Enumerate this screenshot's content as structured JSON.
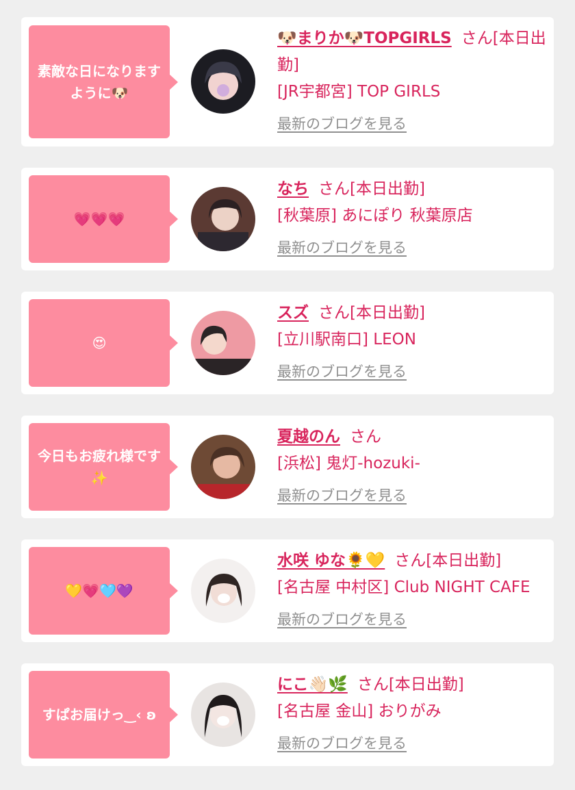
{
  "cards": [
    {
      "message": "素敵な日になりますように🐶",
      "name": "🐶まりか🐶TOPGIRLS",
      "suffix": "さん[本日出勤]",
      "shop": "[JR宇都宮] TOP GIRLS",
      "blog_link": "最新のブログを見る",
      "avatar_colors": [
        "#1c1c22",
        "#f1d3d0",
        "#3a3a48"
      ]
    },
    {
      "message": "💗💗💗",
      "name": "なち",
      "suffix": "さん[本日出勤]",
      "shop": "[秋葉原] あにぽり 秋葉原店",
      "blog_link": "最新のブログを見る",
      "avatar_colors": [
        "#5b3a33",
        "#ecd2c6",
        "#2b2022"
      ]
    },
    {
      "message": "😍",
      "name": "スズ",
      "suffix": "さん[本日出勤]",
      "shop": "[立川駅南口] LEON",
      "blog_link": "最新のブログを見る",
      "avatar_colors": [
        "#ee9aa3",
        "#f4d8cc",
        "#2a2426"
      ]
    },
    {
      "message": "今日もお疲れ様です✨",
      "name": "夏越のん",
      "suffix": "さん",
      "shop": "[浜松] 鬼灯-hozuki-",
      "blog_link": "最新のブログを見る",
      "avatar_colors": [
        "#6e4a35",
        "#e6b9a3",
        "#b7262b"
      ]
    },
    {
      "message": "💛💗🩵💜",
      "name": "水咲 ゆな🌻💛",
      "suffix": "さん[本日出勤]",
      "shop": "[名古屋 中村区] Club NIGHT CAFE",
      "blog_link": "最新のブログを見る",
      "avatar_colors": [
        "#f3f0ef",
        "#f1ddd6",
        "#2f2523"
      ]
    },
    {
      "message": "すぱお届けっ‿‹ ʚ",
      "name": "にこ👋🏻🌿",
      "suffix": "さん[本日出勤]",
      "shop": "[名古屋 金山] おりがみ",
      "blog_link": "最新のブログを見る",
      "avatar_colors": [
        "#e8e4e2",
        "#f3e6e2",
        "#1f1a1b"
      ]
    }
  ]
}
